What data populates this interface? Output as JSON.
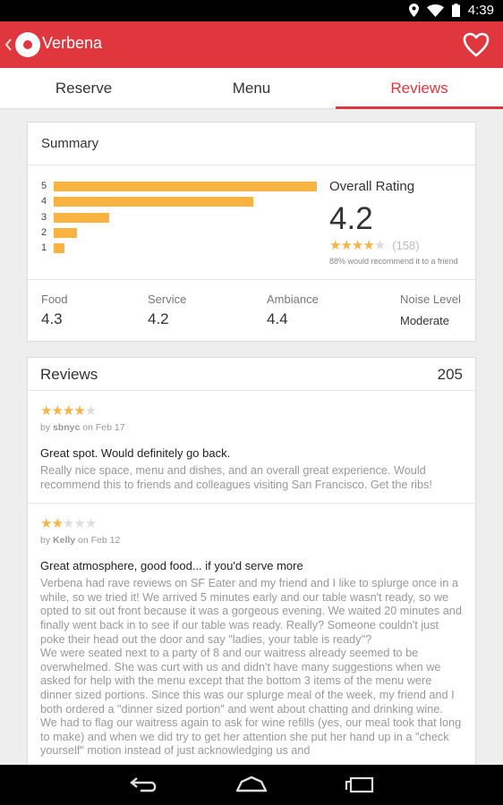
{
  "status_bar": {
    "time": "4:39",
    "icons": [
      "location-icon",
      "wifi-icon",
      "battery-icon"
    ]
  },
  "app_bar": {
    "title": "Verbena",
    "icons": [
      "back-chevron-icon",
      "app-logo-icon",
      "heart-icon"
    ],
    "color": "#e0373f"
  },
  "tabs": [
    {
      "label": "Reserve",
      "active": false
    },
    {
      "label": "Menu",
      "active": false
    },
    {
      "label": "Reviews",
      "active": true
    }
  ],
  "summary": {
    "heading": "Summary",
    "distribution": [
      {
        "stars": "5",
        "fraction": 1.0
      },
      {
        "stars": "4",
        "fraction": 0.76
      },
      {
        "stars": "3",
        "fraction": 0.21
      },
      {
        "stars": "2",
        "fraction": 0.09
      },
      {
        "stars": "1",
        "fraction": 0.04
      }
    ],
    "overall_label": "Overall Rating",
    "overall_value": "4.2",
    "overall_stars": 4,
    "rating_count": "(158)",
    "recommend": "88% would recommend it to a friend",
    "subratings": [
      {
        "label": "Food",
        "value": "4.3"
      },
      {
        "label": "Service",
        "value": "4.2"
      },
      {
        "label": "Ambiance",
        "value": "4.4"
      },
      {
        "label": "Noise Level",
        "value": "Moderate"
      }
    ]
  },
  "reviews": {
    "heading": "Reviews",
    "count": "205",
    "items": [
      {
        "stars": 4,
        "by_prefix": "by",
        "author": "sbnyc",
        "date": "on Feb 17",
        "title": "Great spot. Would definitely go back.",
        "body": "Really nice space, menu and dishes, and an overall great experience. Would recommend this to friends and colleagues visiting San Francisco. Get the ribs!"
      },
      {
        "stars": 2,
        "by_prefix": "by",
        "author": "Kelly",
        "date": "on Feb 12",
        "title": "Great atmosphere, good food... if you'd serve more",
        "body": "Verbena had rave reviews on SF Eater and my friend and I like to splurge once in a while, so we tried it!  We arrived 5 minutes early and our table wasn't ready, so we opted to sit out front because it was a gorgeous evening.  We waited 20 minutes and finally went back in to see if our table was ready.  Really? Someone couldn't just poke their head out the door and say \"ladies, your table is ready\"?\nWe were seated next to a party of 8 and our waitress already seemed to be overwhelmed.  She was curt with us and didn't have many suggestions when we asked for help with the menu except that the bottom 3 items of the menu were dinner sized portions.  Since this was our splurge meal of the week, my friend and I both ordered a \"dinner sized portion\" and went about chatting and drinking wine.  We had to flag our waitress again to ask for wine refills (yes, our meal took that long to make) and when we did try to get her attention she put her hand up in a \"check yourself\" motion instead of just acknowledging us and"
      }
    ]
  },
  "nav_bar": {
    "icons": [
      "back-icon",
      "home-icon",
      "recents-icon"
    ]
  },
  "colors": {
    "accent": "#e0373f",
    "star": "#f8b342",
    "bar": "#f8b342"
  }
}
